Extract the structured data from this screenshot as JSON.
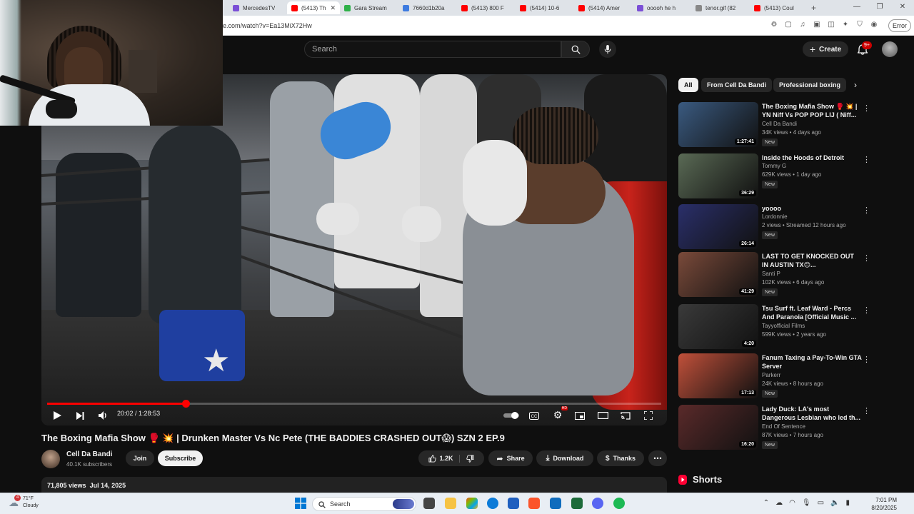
{
  "browser": {
    "tabs": [
      {
        "label": "MercedesTV",
        "color": "#7b4fd6"
      },
      {
        "label": "(5413) Th",
        "color": "#ff0000",
        "active": true
      },
      {
        "label": "Gara Stream",
        "color": "#2fb14a"
      },
      {
        "label": "7660d1b20a",
        "color": "#3d7be0"
      },
      {
        "label": "(5413) 800 F",
        "color": "#ff0000"
      },
      {
        "label": "(5414) 10-6",
        "color": "#ff0000"
      },
      {
        "label": "(5414) Amer",
        "color": "#ff0000"
      },
      {
        "label": "ooooh he h",
        "color": "#7b4fd6"
      },
      {
        "label": "tenor.gif (82",
        "color": "#888888"
      },
      {
        "label": "(5413) Coul",
        "color": "#ff0000"
      }
    ],
    "close_glyph": "✕",
    "newtab_glyph": "+",
    "url": "e.com/watch?v=Ea13MiX72Hw",
    "error_label": "Error"
  },
  "header": {
    "search_placeholder": "Search",
    "create_label": "Create",
    "notif_badge": "9+"
  },
  "player": {
    "current_time": "20:02",
    "duration": "1:28:53",
    "progress_fraction": 0.2254,
    "hd_badge": "HD"
  },
  "video": {
    "title": "The Boxing Mafia Show 🥊 💥 | Drunken Master Vs Nc Pete (THE BADDIES CRASHED OUT😱) SZN 2 EP.9",
    "channel": "Cell Da Bandi",
    "subscribers": "40.1K subscribers",
    "join_label": "Join",
    "subscribe_label": "Subscribe",
    "likes": "1.2K",
    "share_label": "Share",
    "download_label": "Download",
    "thanks_label": "Thanks",
    "views": "71,805 views",
    "date": "Jul 14, 2025"
  },
  "chips": [
    {
      "label": "All",
      "active": true
    },
    {
      "label": "From Cell Da Bandi"
    },
    {
      "label": "Professional boxing"
    }
  ],
  "recommendations": [
    {
      "title": "The Boxing Mafia Show 🥊 💥 | YN Niff Vs POP POP LIJ ( Niff...",
      "channel": "Cell Da Bandi",
      "meta": "34K views • 4 days ago",
      "duration": "1:27:41",
      "new_label": "New",
      "thumb": "#3a5a80"
    },
    {
      "title": "Inside the Hoods of Detroit",
      "channel": "Tommy G",
      "meta": "629K views • 1 day ago",
      "duration": "36:29",
      "new_label": "New",
      "thumb": "#5a6a55"
    },
    {
      "title": "yoooo",
      "channel": "Lordonnie",
      "meta": "2 views • Streamed 12 hours ago",
      "duration": "26:14",
      "new_label": "New",
      "thumb": "#2a2f6a"
    },
    {
      "title": "LAST TO GET KNOCKED OUT IN AUSTIN TX😊...",
      "channel": "Santi P",
      "meta": "102K views • 6 days ago",
      "duration": "41:29",
      "new_label": "New",
      "thumb": "#7a4a3a"
    },
    {
      "title": "Tsu Surf ft. Leaf Ward - Percs And Paranoia [Official Music ...",
      "channel": "Tayyofficial Films",
      "meta": "599K views • 2 years ago",
      "duration": "4:20",
      "thumb": "#3a3a3a"
    },
    {
      "title": "Fanum Taxing a Pay-To-Win GTA Server",
      "channel": "Parkerr",
      "meta": "24K views • 8 hours ago",
      "duration": "17:13",
      "new_label": "New",
      "thumb": "#c0503a"
    },
    {
      "title": "Lady Duck: LA's most Dangerous Lesbian who led th...",
      "channel": "End Of Sentence",
      "meta": "87K views • 7 hours ago",
      "duration": "16:20",
      "new_label": "New",
      "thumb": "#5a2a2a"
    }
  ],
  "shorts_label": "Shorts",
  "taskbar": {
    "temp": "71°F",
    "condition": "Cloudy",
    "weather_badge": "4",
    "search_label": "Search",
    "time": "7:01 PM",
    "date": "8/20/2025"
  }
}
